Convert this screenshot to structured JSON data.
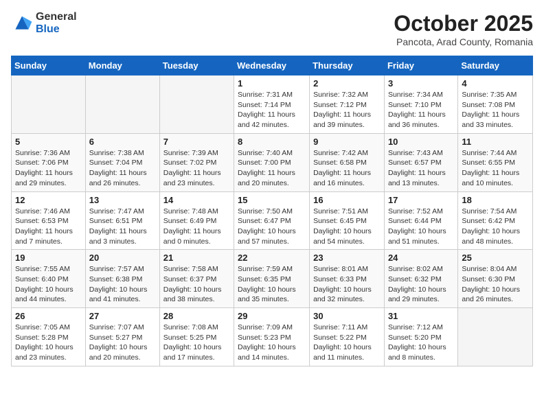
{
  "logo": {
    "general": "General",
    "blue": "Blue"
  },
  "header": {
    "month": "October 2025",
    "location": "Pancota, Arad County, Romania"
  },
  "weekdays": [
    "Sunday",
    "Monday",
    "Tuesday",
    "Wednesday",
    "Thursday",
    "Friday",
    "Saturday"
  ],
  "weeks": [
    [
      {
        "day": "",
        "details": ""
      },
      {
        "day": "",
        "details": ""
      },
      {
        "day": "",
        "details": ""
      },
      {
        "day": "1",
        "details": "Sunrise: 7:31 AM\nSunset: 7:14 PM\nDaylight: 11 hours\nand 42 minutes."
      },
      {
        "day": "2",
        "details": "Sunrise: 7:32 AM\nSunset: 7:12 PM\nDaylight: 11 hours\nand 39 minutes."
      },
      {
        "day": "3",
        "details": "Sunrise: 7:34 AM\nSunset: 7:10 PM\nDaylight: 11 hours\nand 36 minutes."
      },
      {
        "day": "4",
        "details": "Sunrise: 7:35 AM\nSunset: 7:08 PM\nDaylight: 11 hours\nand 33 minutes."
      }
    ],
    [
      {
        "day": "5",
        "details": "Sunrise: 7:36 AM\nSunset: 7:06 PM\nDaylight: 11 hours\nand 29 minutes."
      },
      {
        "day": "6",
        "details": "Sunrise: 7:38 AM\nSunset: 7:04 PM\nDaylight: 11 hours\nand 26 minutes."
      },
      {
        "day": "7",
        "details": "Sunrise: 7:39 AM\nSunset: 7:02 PM\nDaylight: 11 hours\nand 23 minutes."
      },
      {
        "day": "8",
        "details": "Sunrise: 7:40 AM\nSunset: 7:00 PM\nDaylight: 11 hours\nand 20 minutes."
      },
      {
        "day": "9",
        "details": "Sunrise: 7:42 AM\nSunset: 6:58 PM\nDaylight: 11 hours\nand 16 minutes."
      },
      {
        "day": "10",
        "details": "Sunrise: 7:43 AM\nSunset: 6:57 PM\nDaylight: 11 hours\nand 13 minutes."
      },
      {
        "day": "11",
        "details": "Sunrise: 7:44 AM\nSunset: 6:55 PM\nDaylight: 11 hours\nand 10 minutes."
      }
    ],
    [
      {
        "day": "12",
        "details": "Sunrise: 7:46 AM\nSunset: 6:53 PM\nDaylight: 11 hours\nand 7 minutes."
      },
      {
        "day": "13",
        "details": "Sunrise: 7:47 AM\nSunset: 6:51 PM\nDaylight: 11 hours\nand 3 minutes."
      },
      {
        "day": "14",
        "details": "Sunrise: 7:48 AM\nSunset: 6:49 PM\nDaylight: 11 hours\nand 0 minutes."
      },
      {
        "day": "15",
        "details": "Sunrise: 7:50 AM\nSunset: 6:47 PM\nDaylight: 10 hours\nand 57 minutes."
      },
      {
        "day": "16",
        "details": "Sunrise: 7:51 AM\nSunset: 6:45 PM\nDaylight: 10 hours\nand 54 minutes."
      },
      {
        "day": "17",
        "details": "Sunrise: 7:52 AM\nSunset: 6:44 PM\nDaylight: 10 hours\nand 51 minutes."
      },
      {
        "day": "18",
        "details": "Sunrise: 7:54 AM\nSunset: 6:42 PM\nDaylight: 10 hours\nand 48 minutes."
      }
    ],
    [
      {
        "day": "19",
        "details": "Sunrise: 7:55 AM\nSunset: 6:40 PM\nDaylight: 10 hours\nand 44 minutes."
      },
      {
        "day": "20",
        "details": "Sunrise: 7:57 AM\nSunset: 6:38 PM\nDaylight: 10 hours\nand 41 minutes."
      },
      {
        "day": "21",
        "details": "Sunrise: 7:58 AM\nSunset: 6:37 PM\nDaylight: 10 hours\nand 38 minutes."
      },
      {
        "day": "22",
        "details": "Sunrise: 7:59 AM\nSunset: 6:35 PM\nDaylight: 10 hours\nand 35 minutes."
      },
      {
        "day": "23",
        "details": "Sunrise: 8:01 AM\nSunset: 6:33 PM\nDaylight: 10 hours\nand 32 minutes."
      },
      {
        "day": "24",
        "details": "Sunrise: 8:02 AM\nSunset: 6:32 PM\nDaylight: 10 hours\nand 29 minutes."
      },
      {
        "day": "25",
        "details": "Sunrise: 8:04 AM\nSunset: 6:30 PM\nDaylight: 10 hours\nand 26 minutes."
      }
    ],
    [
      {
        "day": "26",
        "details": "Sunrise: 7:05 AM\nSunset: 5:28 PM\nDaylight: 10 hours\nand 23 minutes."
      },
      {
        "day": "27",
        "details": "Sunrise: 7:07 AM\nSunset: 5:27 PM\nDaylight: 10 hours\nand 20 minutes."
      },
      {
        "day": "28",
        "details": "Sunrise: 7:08 AM\nSunset: 5:25 PM\nDaylight: 10 hours\nand 17 minutes."
      },
      {
        "day": "29",
        "details": "Sunrise: 7:09 AM\nSunset: 5:23 PM\nDaylight: 10 hours\nand 14 minutes."
      },
      {
        "day": "30",
        "details": "Sunrise: 7:11 AM\nSunset: 5:22 PM\nDaylight: 10 hours\nand 11 minutes."
      },
      {
        "day": "31",
        "details": "Sunrise: 7:12 AM\nSunset: 5:20 PM\nDaylight: 10 hours\nand 8 minutes."
      },
      {
        "day": "",
        "details": ""
      }
    ]
  ]
}
